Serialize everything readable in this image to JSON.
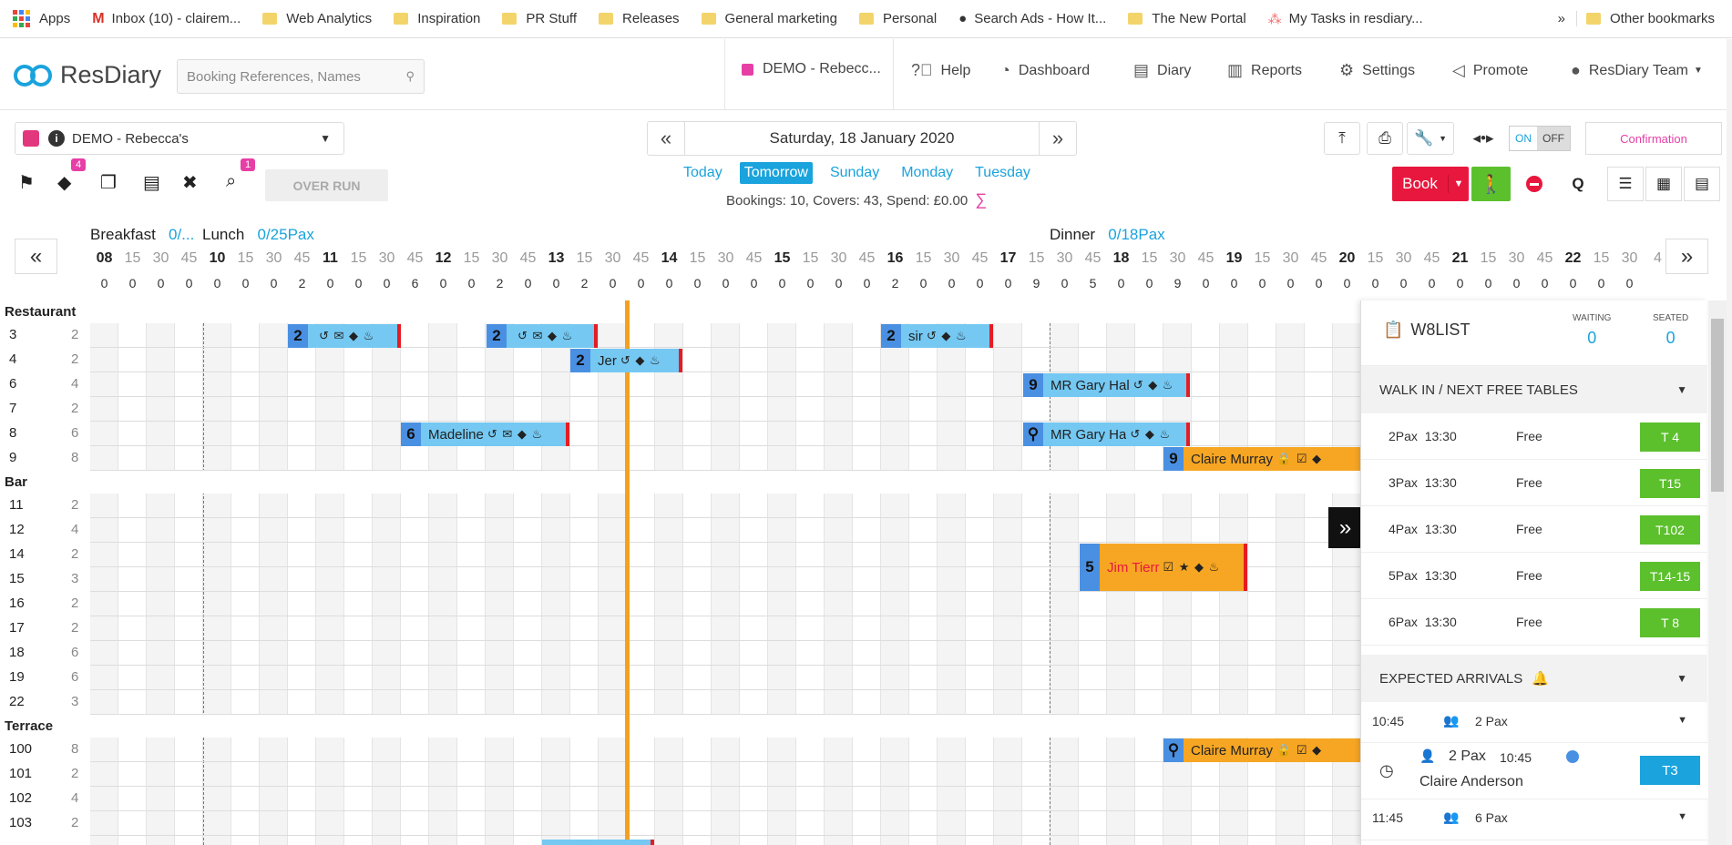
{
  "bookmarks": [
    {
      "label": "Apps",
      "icon": "apps-icon"
    },
    {
      "label": "Inbox (10) - clairem...",
      "icon": "gmail-icon"
    },
    {
      "label": "Web Analytics",
      "icon": "folder-icon"
    },
    {
      "label": "Inspiration",
      "icon": "folder-icon"
    },
    {
      "label": "PR Stuff",
      "icon": "folder-icon"
    },
    {
      "label": "Releases",
      "icon": "folder-icon"
    },
    {
      "label": "General marketing",
      "icon": "folder-icon"
    },
    {
      "label": "Personal",
      "icon": "folder-icon"
    },
    {
      "label": "Search Ads - How It...",
      "icon": "apple-icon"
    },
    {
      "label": "The New Portal",
      "icon": "folder-icon"
    },
    {
      "label": "My Tasks in resdiary...",
      "icon": "asana-icon"
    }
  ],
  "bookmarks_more": "»",
  "bookmarks_other": "Other bookmarks",
  "app": {
    "logo": "ResDiary",
    "search_placeholder": "Booking References, Names",
    "restaurant_short": "DEMO - Rebecc...",
    "nav": [
      {
        "label": "Help",
        "icon": "help-icon"
      },
      {
        "label": "Dashboard",
        "icon": "dashboard-icon"
      },
      {
        "label": "Diary",
        "icon": "diary-icon"
      },
      {
        "label": "Reports",
        "icon": "reports-icon"
      },
      {
        "label": "Settings",
        "icon": "gear-icon"
      },
      {
        "label": "Promote",
        "icon": "megaphone-icon"
      },
      {
        "label": "ResDiary Team",
        "icon": "user-icon"
      }
    ]
  },
  "toolbar": {
    "restaurant_select": "DEMO - Rebecca's",
    "tag_badge": "4",
    "search_badge": "1",
    "overrun": "OVER RUN",
    "date": "Saturday, 18 January 2020",
    "prev": "«",
    "next": "»",
    "days": [
      "Today",
      "Tomorrow",
      "Sunday",
      "Monday",
      "Tuesday"
    ],
    "active_day": "Tomorrow",
    "stats": {
      "bookings_label": "Bookings: ",
      "bookings": "10",
      "covers_label": ", Covers: ",
      "covers": "43",
      "spend_label": ", Spend: ",
      "spend": "£0.00"
    },
    "on": "ON",
    "off": "OFF",
    "confirmation": "Confirmation",
    "book": "Book",
    "q": "Q"
  },
  "periods": [
    {
      "name": "Breakfast",
      "pax": "0/..."
    },
    {
      "name": "Lunch",
      "pax": "0/25Pax"
    },
    {
      "name": "Dinner",
      "pax": "0/18Pax"
    }
  ],
  "timeline": {
    "slots": [
      "08",
      "15",
      "30",
      "45",
      "10",
      "15",
      "30",
      "45",
      "11",
      "15",
      "30",
      "45",
      "12",
      "15",
      "30",
      "45",
      "13",
      "15",
      "30",
      "45",
      "14",
      "15",
      "30",
      "45",
      "15",
      "15",
      "30",
      "45",
      "16",
      "15",
      "30",
      "45",
      "17",
      "15",
      "30",
      "45",
      "18",
      "15",
      "30",
      "45",
      "19",
      "15",
      "30",
      "45",
      "20",
      "15",
      "30",
      "45",
      "21",
      "15",
      "30",
      "45",
      "22",
      "15",
      "30",
      "4"
    ],
    "counts": [
      "0",
      "0",
      "0",
      "0",
      "0",
      "0",
      "0",
      "2",
      "0",
      "0",
      "0",
      "6",
      "0",
      "0",
      "2",
      "0",
      "0",
      "2",
      "0",
      "0",
      "0",
      "0",
      "0",
      "0",
      "0",
      "0",
      "0",
      "0",
      "2",
      "0",
      "0",
      "0",
      "0",
      "9",
      "0",
      "5",
      "0",
      "0",
      "9",
      "0",
      "0",
      "0",
      "0",
      "0",
      "0",
      "0",
      "0",
      "0",
      "0",
      "0",
      "0",
      "0",
      "0",
      "0",
      "0"
    ]
  },
  "sections": [
    {
      "name": "Restaurant",
      "tables": [
        [
          "3",
          "2"
        ],
        [
          "4",
          "2"
        ],
        [
          "6",
          "4"
        ],
        [
          "7",
          "2"
        ],
        [
          "8",
          "6"
        ],
        [
          "9",
          "8"
        ]
      ]
    },
    {
      "name": "Bar",
      "tables": [
        [
          "11",
          "2"
        ],
        [
          "12",
          "4"
        ],
        [
          "14",
          "2"
        ],
        [
          "15",
          "3"
        ],
        [
          "16",
          "2"
        ],
        [
          "17",
          "2"
        ],
        [
          "18",
          "6"
        ],
        [
          "19",
          "6"
        ],
        [
          "22",
          "3"
        ]
      ]
    },
    {
      "name": "Terrace",
      "tables": [
        [
          "100",
          "8"
        ],
        [
          "101",
          "2"
        ],
        [
          "102",
          "4"
        ],
        [
          "103",
          "2"
        ]
      ]
    }
  ],
  "bookings": [
    {
      "num": "2",
      "name": "",
      "icons": "↺ ✉ ◆ ♨",
      "style": "blue"
    },
    {
      "num": "2",
      "name": "",
      "icons": "↺ ✉ ◆ ♨",
      "style": "blue"
    },
    {
      "num": "2",
      "name": "sir",
      "icons": "↺ ◆ ♨",
      "style": "blue"
    },
    {
      "num": "2",
      "name": "Jer",
      "icons": "↺ ◆ ♨",
      "style": "blue"
    },
    {
      "num": "9",
      "name": "MR Gary Hal",
      "icons": "↺ ◆ ♨",
      "style": "blue"
    },
    {
      "num": "6",
      "name": "Madeline",
      "icons": "↺ ✉ ◆ ♨",
      "style": "blue"
    },
    {
      "num": "⚲",
      "name": "MR Gary Ha",
      "icons": "↺ ◆ ♨",
      "style": "blue"
    },
    {
      "num": "9",
      "name": "Claire Murray",
      "icons": "🔒 ☑ ◆",
      "style": "orange"
    },
    {
      "num": "5",
      "name": "Jim Tierr",
      "icons": "☑ ★ ◆ ♨",
      "style": "orange"
    },
    {
      "num": "⚲",
      "name": "Claire Murray",
      "icons": "🔒 ☑ ◆",
      "style": "orange"
    }
  ],
  "w8list": {
    "title": "W8LIST",
    "waiting_label": "WAITING",
    "waiting": "0",
    "seated_label": "SEATED",
    "seated": "0",
    "walkin_title": "WALK IN / NEXT FREE TABLES",
    "free": [
      {
        "pax": "2Pax",
        "time": "13:30",
        "status": "Free",
        "table": "T 4"
      },
      {
        "pax": "3Pax",
        "time": "13:30",
        "status": "Free",
        "table": "T15"
      },
      {
        "pax": "4Pax",
        "time": "13:30",
        "status": "Free",
        "table": "T102"
      },
      {
        "pax": "5Pax",
        "time": "13:30",
        "status": "Free",
        "table": "T14-15"
      },
      {
        "pax": "6Pax",
        "time": "13:30",
        "status": "Free",
        "table": "T 8"
      }
    ],
    "arrivals_title": "EXPECTED ARRIVALS",
    "arrivals": [
      {
        "time": "10:45",
        "pax": "2 Pax",
        "guest_pax": "2 Pax",
        "guest_time": "10:45",
        "guest": "Claire Anderson",
        "table": "T3"
      },
      {
        "time": "11:45",
        "pax": "6 Pax"
      }
    ]
  },
  "colors": {
    "accent": "#1aa3dd",
    "brand_pink": "#e63fa5",
    "book_red": "#e8173d",
    "walk_green": "#5cc02d",
    "booking_blue": "#74c8f2",
    "booking_orange": "#f6a623",
    "now_line": "#f3a11e"
  }
}
